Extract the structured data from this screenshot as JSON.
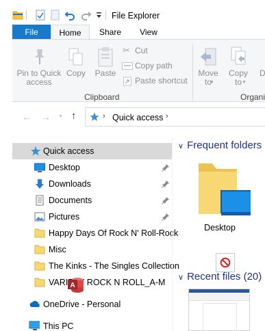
{
  "window": {
    "title": "File Explorer"
  },
  "ribbon_tabs": [
    {
      "label": "File"
    },
    {
      "label": "Home"
    },
    {
      "label": "Share"
    },
    {
      "label": "View"
    }
  ],
  "ribbon": {
    "pin_to_quick_access": "Pin to Quick access",
    "copy": "Copy",
    "paste": "Paste",
    "cut": "Cut",
    "copy_path": "Copy path",
    "paste_shortcut": "Paste shortcut",
    "clipboard_group": "Clipboard",
    "move_to": "Move to",
    "copy_to": "Copy to",
    "organize_group": "Organi",
    "delete_partial": "D"
  },
  "address": {
    "path": "Quick access"
  },
  "nav_pane": {
    "items": [
      {
        "label": "Quick access",
        "icon": "star-icon"
      },
      {
        "label": "Desktop",
        "icon": "desktop-icon",
        "pinned": true
      },
      {
        "label": "Downloads",
        "icon": "download-icon",
        "pinned": true
      },
      {
        "label": "Documents",
        "icon": "documents-icon",
        "pinned": true
      },
      {
        "label": "Pictures",
        "icon": "pictures-icon",
        "pinned": true
      },
      {
        "label": "Happy Days Of Rock N' Roll-Rock",
        "icon": "folder-icon"
      },
      {
        "label": "Misc",
        "icon": "folder-icon"
      },
      {
        "label": "The Kinks - The Singles Collection",
        "icon": "folder-icon"
      },
      {
        "label": "VARIETY ROCK N ROLL_A-M",
        "icon": "folder-icon"
      },
      {
        "label": "OneDrive - Personal",
        "icon": "onedrive-icon"
      },
      {
        "label": "This PC",
        "icon": "computer-icon"
      }
    ]
  },
  "content": {
    "frequent_header": "Frequent folders",
    "frequent_items": [
      {
        "label": "Desktop"
      }
    ],
    "recent_header": "Recent files (20)"
  },
  "colors": {
    "accent": "#1979ca",
    "section_header": "#1e3287",
    "selected_bg": "#d9d9d9",
    "ribbon_bg": "#f5f6f7"
  }
}
